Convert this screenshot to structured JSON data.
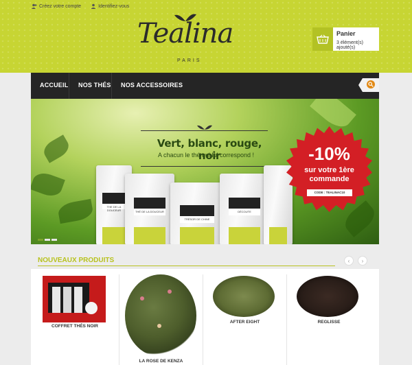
{
  "toplinks": {
    "create_account": "Créez votre compte",
    "login": "Identifiez-vous"
  },
  "logo": {
    "name": "Tealina",
    "subtitle": "PARIS"
  },
  "cart": {
    "title": "Panier",
    "status": "3 élément(s) ajouté(s)"
  },
  "nav": {
    "items": [
      {
        "label": "ACCUEIL"
      },
      {
        "label": "NOS THÉS"
      },
      {
        "label": "NOS ACCESSOIRES"
      }
    ]
  },
  "banner": {
    "headline": "Vert, blanc, rouge, noir",
    "tagline": "A chacun le thé qui lui correspond !",
    "packs": [
      {
        "label": "THE DE LA DOUCEUR"
      },
      {
        "label": "THÉ DE LA DOUCEUR"
      },
      {
        "label": "TRÉSOR DE CHINE"
      },
      {
        "label": "DÉCOUTE"
      }
    ],
    "promo": {
      "discount": "-10%",
      "line1": "sur votre 1ère",
      "line2": "commande",
      "code": "CODE : TEALINAC10"
    }
  },
  "new_products": {
    "title": "NOUVEAUX PRODUITS",
    "prev_icon": "‹",
    "next_icon": "›",
    "items": [
      {
        "name": "COFFRET THÉS NOIR"
      },
      {
        "name": "LA ROSE DE KENZA"
      },
      {
        "name": "AFTER EIGHT"
      },
      {
        "name": "REGLISSE"
      }
    ]
  },
  "colors": {
    "header_green": "#c7d533",
    "nav_dark": "#252525",
    "accent_orange": "#e28a17",
    "promo_red": "#d31f25",
    "section_title_green": "#b8c21e"
  }
}
